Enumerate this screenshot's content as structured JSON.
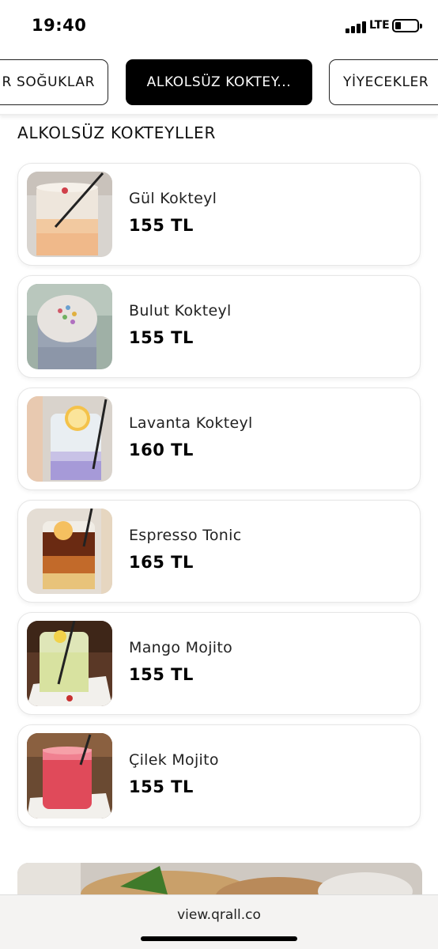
{
  "status": {
    "time": "19:40",
    "network": "LTE"
  },
  "tabs": [
    {
      "label": "R SOĞUKLAR",
      "active": false
    },
    {
      "label": "ALKOLSÜZ KOKTEY...",
      "active": true
    },
    {
      "label": "YİYECEKLER",
      "active": false
    }
  ],
  "section_title": "ALKOLSÜZ KOKTEYLLER",
  "products": [
    {
      "name": "Gül Kokteyl",
      "price": "155 TL",
      "image": "pink-lemonade-glass"
    },
    {
      "name": "Bulut Kokteyl",
      "price": "155 TL",
      "image": "foam-cloud-glass"
    },
    {
      "name": "Lavanta Kokteyl",
      "price": "160 TL",
      "image": "lavender-lemon-glass"
    },
    {
      "name": "Espresso Tonic",
      "price": "165 TL",
      "image": "espresso-tonic-glass"
    },
    {
      "name": "Mango Mojito",
      "price": "155 TL",
      "image": "mango-mojito-glass"
    },
    {
      "name": "Çilek Mojito",
      "price": "155 TL",
      "image": "strawberry-mojito-glass"
    }
  ],
  "browser": {
    "url": "view.qrall.co"
  }
}
